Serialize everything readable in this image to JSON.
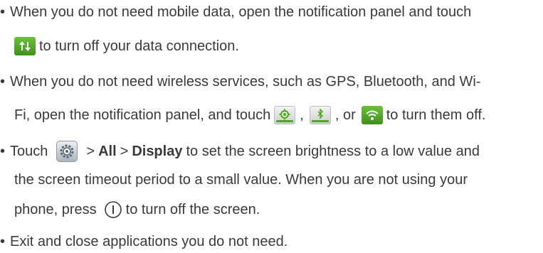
{
  "bullets": {
    "symbol": "•",
    "item1": {
      "line1": "When you do not need mobile data, open the notification panel and touch",
      "line2_after_icon": "to turn off your data connection.",
      "icon": "mobile-data-icon"
    },
    "item2": {
      "line1": "When you do not need wireless services, such as GPS, Bluetooth, and Wi-",
      "line2_before": "Fi, open the notification panel, and touch",
      "sep1": ",",
      "sep2": ", or",
      "line2_end": "to turn them off.",
      "icons": [
        "gps-icon",
        "bluetooth-icon",
        "wifi-icon"
      ]
    },
    "item3": {
      "touch": "Touch",
      "arrow1": ">",
      "all": "All",
      "arrow2": ">",
      "display": "Display",
      "line1_rest": "to set the screen brightness to a low value and",
      "line2": "the screen timeout period to a small value. When you are not using your",
      "line3_before": "phone, press",
      "line3_after": "to turn off the screen.",
      "icons": [
        "settings-icon",
        "power-key-icon"
      ]
    },
    "item4": {
      "text": "Exit and close applications you do not need."
    }
  },
  "colors": {
    "text": "#3a3a3a",
    "icon_green": "#4caa1f"
  }
}
